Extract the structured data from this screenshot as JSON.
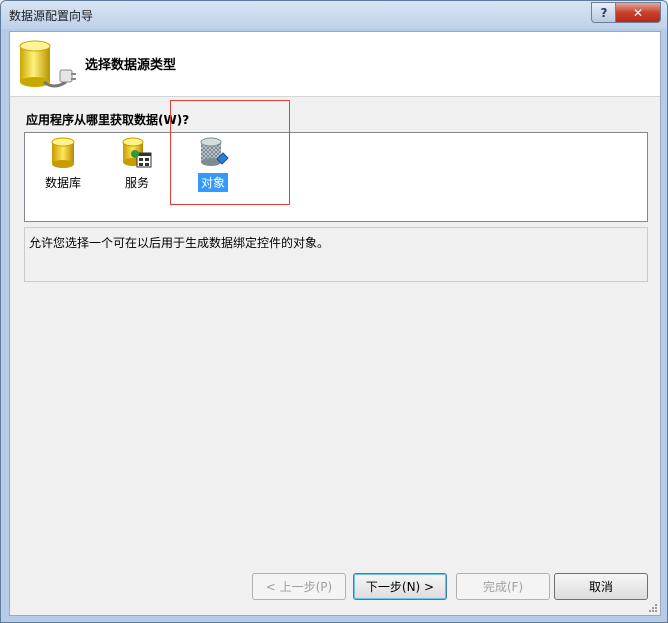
{
  "window": {
    "title": "数据源配置向导",
    "help_label": "?",
    "close_label": "✕"
  },
  "banner": {
    "title": "选择数据源类型",
    "icon": "database-plug-icon"
  },
  "question": "应用程序从哪里获取数据(W)?",
  "types": [
    {
      "label": "数据库",
      "icon": "database-icon",
      "selected": false
    },
    {
      "label": "服务",
      "icon": "service-icon",
      "selected": false
    },
    {
      "label": "对象",
      "icon": "object-icon",
      "selected": true
    }
  ],
  "description": "允许您选择一个可在以后用于生成数据绑定控件的对象。",
  "buttons": {
    "prev": "< 上一步(P)",
    "next": "下一步(N) >",
    "finish": "完成(F)",
    "cancel": "取消"
  },
  "colors": {
    "selection": "#3399ff",
    "highlight_box": "#e53c3c"
  }
}
